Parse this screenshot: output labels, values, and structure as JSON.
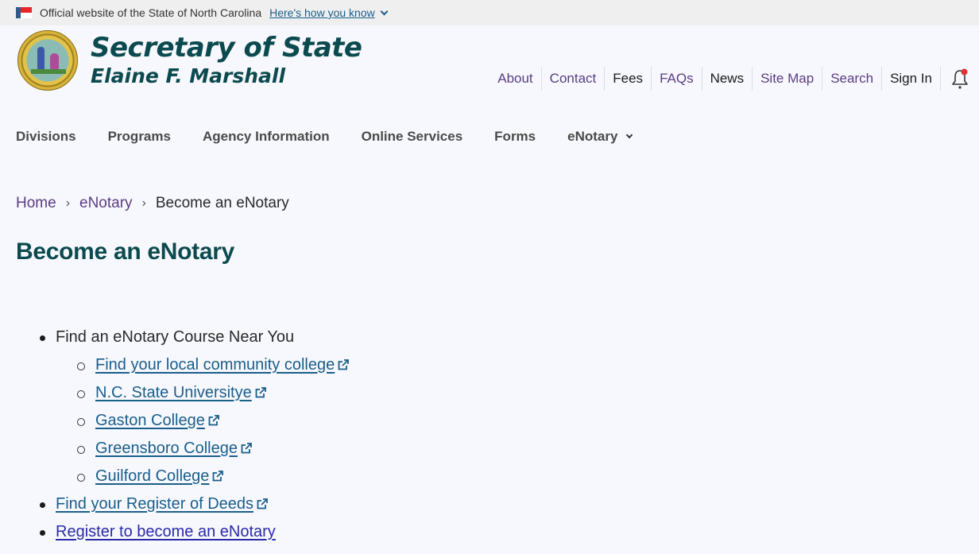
{
  "banner": {
    "official_text": "Official website of the State of North Carolina",
    "how_you_know_label": "Here's how you know",
    "flag_icon": "nc-flag-icon"
  },
  "header": {
    "seal_icon": "nc-state-seal",
    "title": "Secretary of State",
    "subtitle": "Elaine F. Marshall"
  },
  "utility_nav": {
    "items": [
      {
        "label": "About"
      },
      {
        "label": "Contact"
      },
      {
        "label": "Fees"
      },
      {
        "label": "FAQs"
      },
      {
        "label": "News"
      },
      {
        "label": "Site Map"
      },
      {
        "label": "Search"
      },
      {
        "label": "Sign In"
      }
    ],
    "notification_icon": "bell-icon",
    "notification_badge_color": "#e03131"
  },
  "main_nav": {
    "items": [
      {
        "label": "Divisions"
      },
      {
        "label": "Programs"
      },
      {
        "label": "Agency Information"
      },
      {
        "label": "Online Services"
      },
      {
        "label": "Forms"
      },
      {
        "label": "eNotary",
        "has_dropdown": true
      }
    ]
  },
  "breadcrumb": {
    "items": [
      {
        "label": "Home"
      },
      {
        "label": "eNotary"
      }
    ],
    "current": "Become an eNotary",
    "separator": "›"
  },
  "page": {
    "title": "Become an eNotary",
    "list": {
      "find_course": {
        "label": "Find an eNotary Course Near You",
        "links": [
          {
            "label": "Find your local community college",
            "external": true
          },
          {
            "label": "N.C. State Universitye",
            "external": true
          },
          {
            "label": "Gaston College",
            "external": true
          },
          {
            "label": "Greensboro College",
            "external": true
          },
          {
            "label": "Guilford College",
            "external": true
          }
        ]
      },
      "register_of_deeds": {
        "label": "Find your Register of Deeds",
        "external": true
      },
      "register": {
        "label": "Register to become an eNotary",
        "external": false
      }
    }
  },
  "colors": {
    "brand_teal": "#0b4a4e",
    "link_blue": "#1a5e8a",
    "nav_purple": "#5a3d82",
    "background": "#f7f8fd",
    "banner_gray": "#efefef"
  }
}
